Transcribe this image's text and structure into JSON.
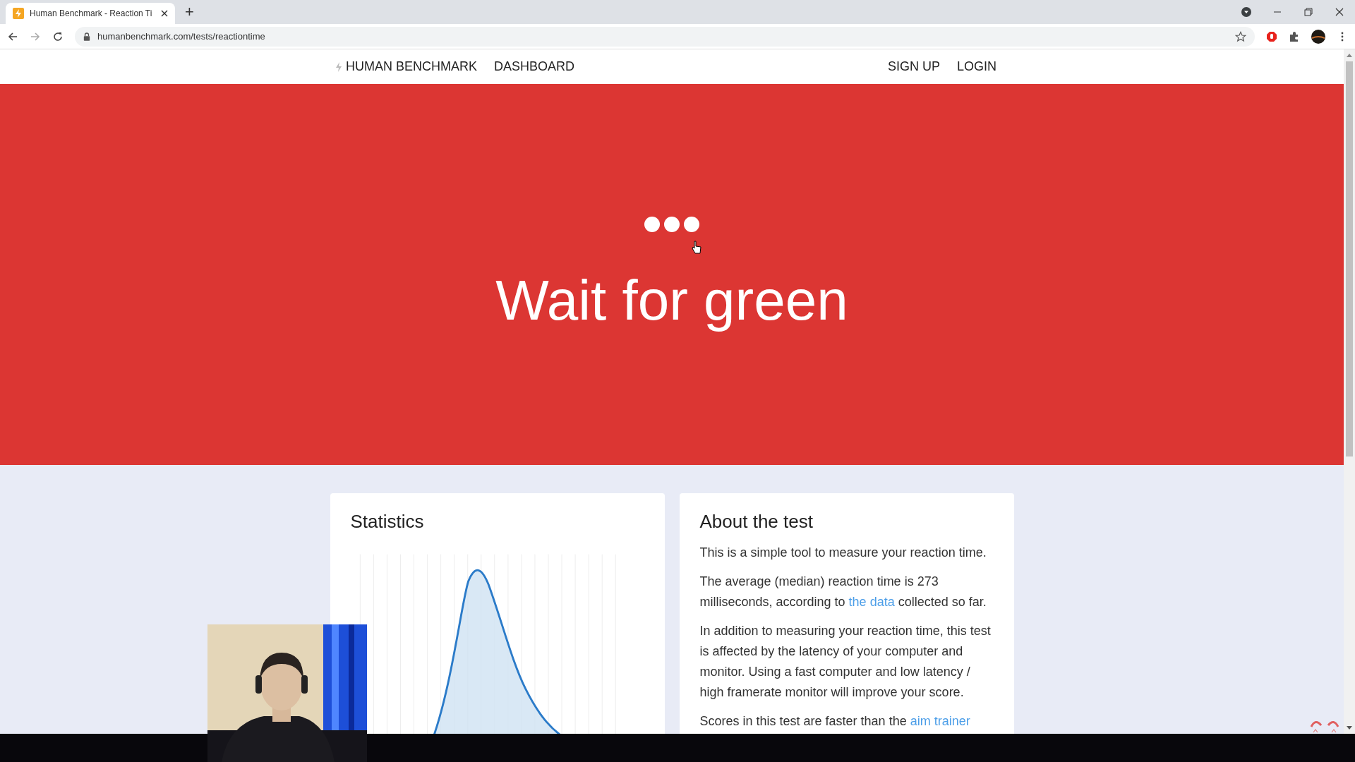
{
  "browser": {
    "tabs": [
      {
        "title": "Human Benchmark - Reaction Ti",
        "selected": true
      }
    ],
    "new_tab": "+",
    "url": "humanbenchmark.com/tests/reactiontime"
  },
  "nav": {
    "brand": "HUMAN BENCHMARK",
    "links": [
      "DASHBOARD"
    ],
    "right_links": [
      "SIGN UP",
      "LOGIN"
    ]
  },
  "hero": {
    "title": "Wait for green"
  },
  "statistics": {
    "title": "Statistics"
  },
  "about": {
    "title": "About the test",
    "paragraphs": [
      [
        {
          "kind": "text",
          "text": "This is a simple tool to measure your reaction time."
        }
      ],
      [
        {
          "kind": "text",
          "text": "The average (median) reaction time is 273 milliseconds, according to "
        },
        {
          "kind": "link",
          "text": "the data"
        },
        {
          "kind": "text",
          "text": " collected so far."
        }
      ],
      [
        {
          "kind": "text",
          "text": "In addition to measuring your reaction time, this test is affected by the latency of your computer and monitor. Using a fast computer and low latency / high framerate monitor will improve your score."
        }
      ],
      [
        {
          "kind": "text",
          "text": "Scores in this test are faster than the "
        },
        {
          "kind": "link",
          "text": "aim trainer"
        }
      ]
    ]
  }
}
